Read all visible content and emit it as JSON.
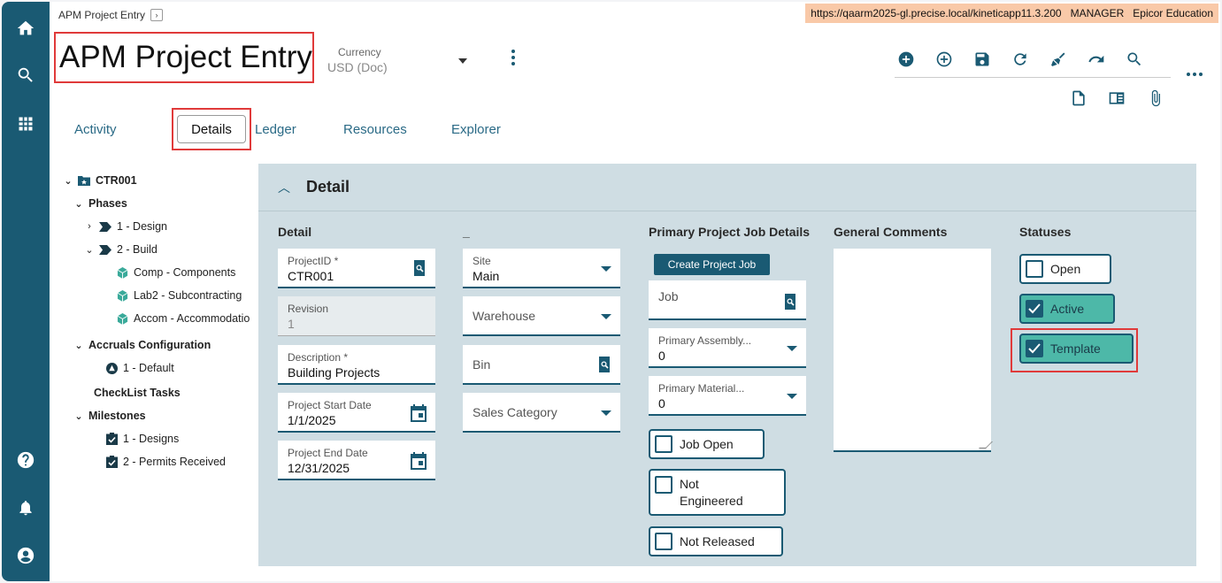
{
  "nav": {
    "items": [
      "home-icon",
      "search-icon",
      "apps-grid-icon"
    ],
    "bottom": [
      "help-icon",
      "bell-icon",
      "account-icon"
    ]
  },
  "header": {
    "breadcrumb": "APM Project Entry",
    "url_text": "https://qaarm2025-gl.precise.local/kineticapp11.3.200",
    "role": "MANAGER",
    "company": "Epicor Education",
    "title": "APM Project Entry",
    "currency_label": "Currency",
    "currency_value": "USD (Doc)"
  },
  "toolbar": {
    "icons": [
      "add-new-icon",
      "add-outline-icon",
      "save-icon",
      "refresh-icon",
      "clear-brush-icon",
      "undo-icon",
      "search-icon",
      "page-icon",
      "panel-icon",
      "attachment-icon"
    ]
  },
  "tabs": [
    {
      "label": "Activity"
    },
    {
      "label": "Details",
      "active": true
    },
    {
      "label": "Ledger"
    },
    {
      "label": "Resources"
    },
    {
      "label": "Explorer"
    }
  ],
  "tree": {
    "root": "CTR001",
    "phases": "Phases",
    "design": "1 - Design",
    "build": "2 - Build",
    "comp": "Comp - Components",
    "lab2": "Lab2 - Subcontracting",
    "accom": "Accom - Accommodatio",
    "accruals": "Accruals Configuration",
    "default": "1 - Default",
    "checklist": "CheckList Tasks",
    "milestones": "Milestones",
    "m1": "1 - Designs",
    "m2": "2 - Permits Received"
  },
  "detail": {
    "section_title": "Detail",
    "col1_header": "Detail",
    "col2_header": "_",
    "col3_header": "Primary Project Job Details",
    "col4_header": "General Comments",
    "col5_header": "Statuses",
    "project_id_label": "ProjectID *",
    "project_id": "CTR001",
    "revision_label": "Revision",
    "revision": "1",
    "description_label": "Description *",
    "description": "Building Projects",
    "start_label": "Project Start Date",
    "start": "1/1/2025",
    "end_label": "Project End Date",
    "end": "12/31/2025",
    "site_label": "Site",
    "site": "Main",
    "warehouse_label": "Warehouse",
    "bin_label": "Bin",
    "sales_cat_label": "Sales Category",
    "create_job_label": "Create Project Job",
    "job_label": "Job",
    "primary_asm_label": "Primary Assembly...",
    "primary_asm": "0",
    "primary_mat_label": "Primary Material...",
    "primary_mat": "0",
    "job_open": "Job Open",
    "not_engineered": "Not Engineered",
    "not_released": "Not Released",
    "status_open": "Open",
    "status_active": "Active",
    "status_template": "Template"
  },
  "colors": {
    "brand": "#1a5a73",
    "checked_fill": "#4db8a8",
    "highlight": "#e03a3a",
    "url_bg": "#f9c9a8"
  }
}
